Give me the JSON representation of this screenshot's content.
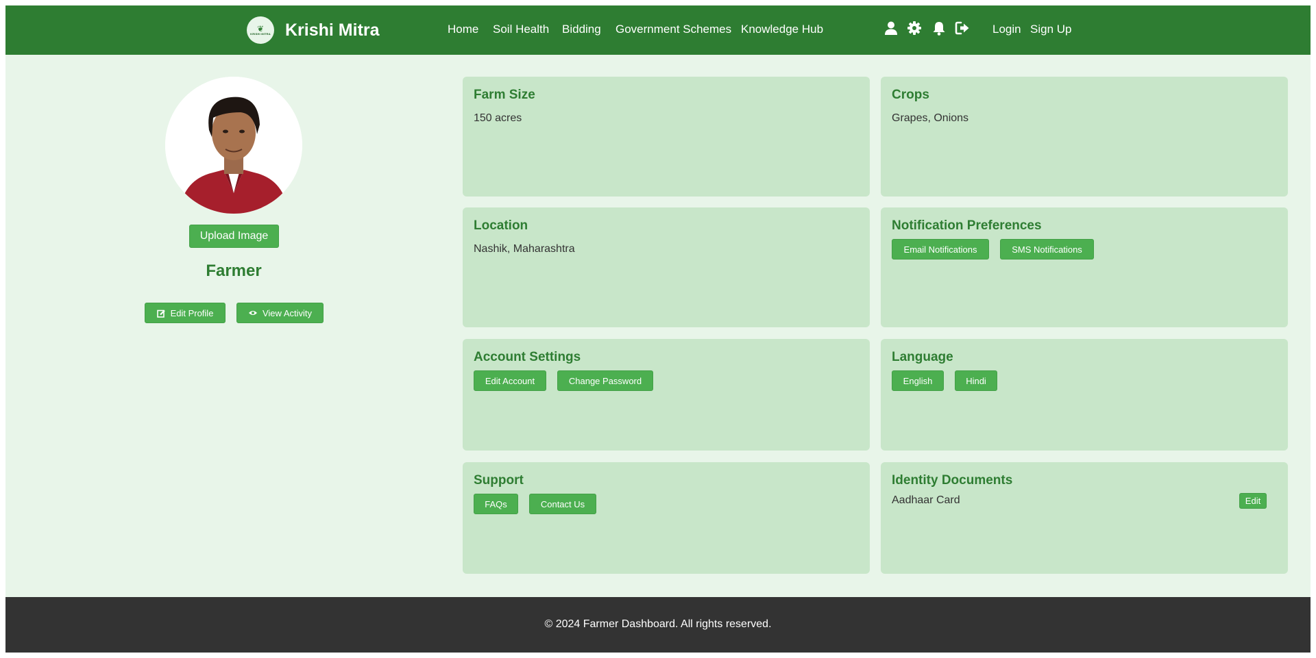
{
  "header": {
    "brand": "Krishi Mitra",
    "logo_text": "KRISHI MITRA",
    "nav": [
      "Home",
      "Soil Health",
      "Bidding",
      "Government Schemes",
      "Knowledge Hub"
    ],
    "icons": [
      "user-icon",
      "gear-icon",
      "bell-icon",
      "logout-icon"
    ],
    "login": "Login",
    "signup": "Sign Up"
  },
  "profile": {
    "upload_label": "Upload Image",
    "role": "Farmer",
    "edit_profile": "Edit Profile",
    "view_activity": "View Activity"
  },
  "cards": {
    "farm_size": {
      "title": "Farm Size",
      "value": "150 acres"
    },
    "crops": {
      "title": "Crops",
      "value": "Grapes, Onions"
    },
    "location": {
      "title": "Location",
      "value": "Nashik, Maharashtra"
    },
    "notifications": {
      "title": "Notification Preferences",
      "email": "Email Notifications",
      "sms": "SMS Notifications"
    },
    "account": {
      "title": "Account Settings",
      "edit": "Edit Account",
      "password": "Change Password"
    },
    "language": {
      "title": "Language",
      "english": "English",
      "hindi": "Hindi"
    },
    "support": {
      "title": "Support",
      "faqs": "FAQs",
      "contact": "Contact Us"
    },
    "identity": {
      "title": "Identity Documents",
      "value": "Aadhaar Card",
      "edit": "Edit"
    }
  },
  "footer": {
    "text": "© 2024 Farmer Dashboard. All rights reserved."
  },
  "colors": {
    "header": "#2e7d32",
    "background": "#e8f5e9",
    "card": "#c8e6c9",
    "button": "#4caf50",
    "footer": "#333333"
  }
}
